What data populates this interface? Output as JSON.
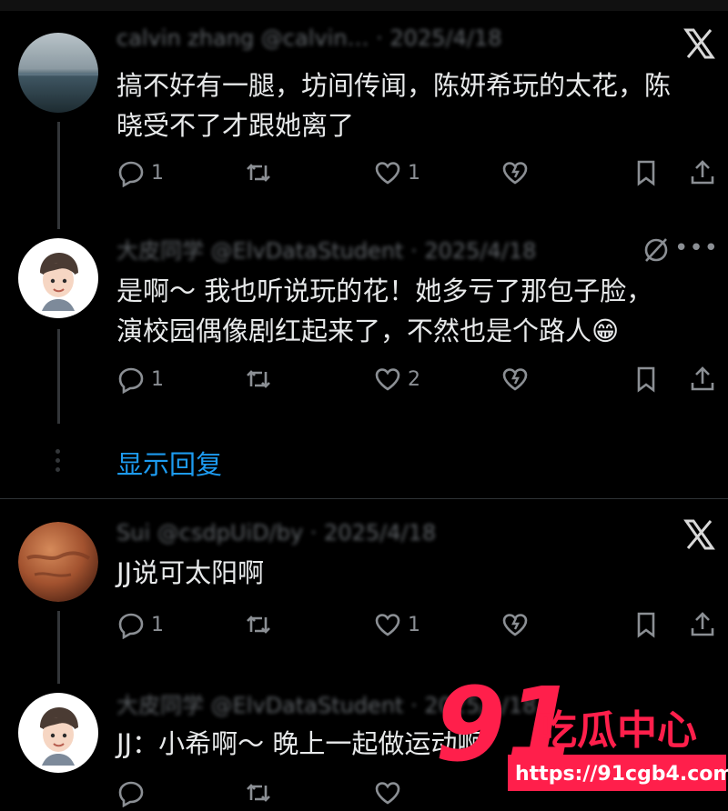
{
  "tweets": [
    {
      "id": "t1",
      "header": "calvin zhang @calvin… · 2025/4/18",
      "text_line1": "搞不好有一腿，坊间传闻，陈妍希玩的太花，陈",
      "text_line2": "晓受不了才跟她离了",
      "reply_count": "1",
      "retweet_count": "",
      "like_count": "1",
      "show_replies": ""
    },
    {
      "id": "t2",
      "header": "大皮同学 @ElvDataStudent · 2025/4/18",
      "text_line1": "是啊～ 我也听说玩的花！她多亏了那包子脸，",
      "text_line2": "演校园偶像剧红起来了，不然也是个路人😁",
      "reply_count": "1",
      "retweet_count": "",
      "like_count": "2",
      "show_replies": "显示回复"
    },
    {
      "id": "t3",
      "header": "Sui @csdpUiD/by · 2025/4/18",
      "text_line1": "JJ说可太阳啊",
      "reply_count": "1",
      "retweet_count": "",
      "like_count": "1"
    },
    {
      "id": "t4",
      "header": "大皮同学 @ElvDataStudent · 2025/4/18",
      "text_line1": "JJ：小希啊～ 晚上一起做运动啊"
    }
  ],
  "watermark": {
    "number": "91",
    "brand": "吃瓜中心",
    "url": "https://91cgb4.com",
    "color": "#ff1f4b"
  },
  "icons": {
    "reply": "reply-icon",
    "retweet": "retweet-icon",
    "like": "heart-icon",
    "dislike": "broken-heart-icon",
    "bookmark": "bookmark-icon",
    "share": "share-icon"
  }
}
